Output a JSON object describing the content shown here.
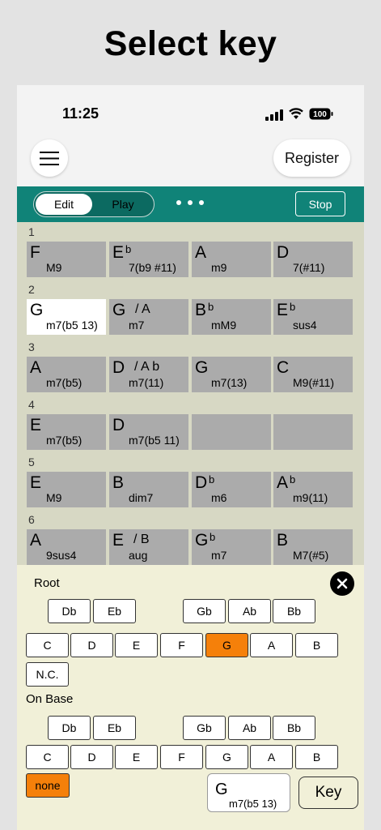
{
  "headline": "Select key",
  "status": {
    "time": "11:25",
    "battery": "100"
  },
  "header": {
    "register_label": "Register"
  },
  "toolbar": {
    "edit_label": "Edit",
    "play_label": "Play",
    "stop_label": "Stop"
  },
  "rows": [
    {
      "num": "1",
      "cells": [
        {
          "root": "F",
          "acc": "",
          "on": "",
          "qual": "M9"
        },
        {
          "root": "E",
          "acc": "b",
          "on": "",
          "qual": "7(b9 #11)"
        },
        {
          "root": "A",
          "acc": "",
          "on": "",
          "qual": "m9"
        },
        {
          "root": "D",
          "acc": "",
          "on": "",
          "qual": "7(#11)"
        }
      ]
    },
    {
      "num": "2",
      "cells": [
        {
          "root": "G",
          "acc": "",
          "on": "",
          "qual": "m7(b5 13)",
          "selected": true
        },
        {
          "root": "G",
          "acc": "",
          "on": "/ A",
          "qual": "m7"
        },
        {
          "root": "B",
          "acc": "b",
          "on": "",
          "qual": "mM9"
        },
        {
          "root": "E",
          "acc": "b",
          "on": "",
          "qual": "sus4"
        }
      ]
    },
    {
      "num": "3",
      "cells": [
        {
          "root": "A",
          "acc": "",
          "on": "",
          "qual": "m7(b5)"
        },
        {
          "root": "D",
          "acc": "",
          "on": "/ A b",
          "qual": "m7(11)"
        },
        {
          "root": "G",
          "acc": "",
          "on": "",
          "qual": "m7(13)"
        },
        {
          "root": "C",
          "acc": "",
          "on": "",
          "qual": "M9(#11)"
        }
      ]
    },
    {
      "num": "4",
      "cells": [
        {
          "root": "E",
          "acc": "",
          "on": "",
          "qual": "m7(b5)"
        },
        {
          "root": "D",
          "acc": "",
          "on": "",
          "qual": "m7(b5 11)"
        },
        {
          "root": "",
          "acc": "",
          "on": "",
          "qual": ""
        },
        {
          "root": "",
          "acc": "",
          "on": "",
          "qual": ""
        }
      ]
    },
    {
      "num": "5",
      "cells": [
        {
          "root": "E",
          "acc": "",
          "on": "",
          "qual": "M9"
        },
        {
          "root": "B",
          "acc": "",
          "on": "",
          "qual": "dim7"
        },
        {
          "root": "D",
          "acc": "b",
          "on": "",
          "qual": "m6"
        },
        {
          "root": "A",
          "acc": "b",
          "on": "",
          "qual": "m9(11)"
        }
      ]
    },
    {
      "num": "6",
      "cells": [
        {
          "root": "A",
          "acc": "",
          "on": "",
          "qual": "9sus4"
        },
        {
          "root": "E",
          "acc": "",
          "on": "/ B",
          "qual": "aug"
        },
        {
          "root": "G",
          "acc": "b",
          "on": "",
          "qual": "m7"
        },
        {
          "root": "B",
          "acc": "",
          "on": "",
          "qual": "M7(#5)"
        }
      ]
    }
  ],
  "panel": {
    "root_label": "Root",
    "onbase_label": "On Base",
    "sharps": [
      "Db",
      "Eb",
      "Gb",
      "Ab",
      "Bb"
    ],
    "naturals": [
      "C",
      "D",
      "E",
      "F",
      "G",
      "A",
      "B"
    ],
    "nc_label": "N.C.",
    "none_label": "none",
    "selected_root": "G",
    "selected_base": "none",
    "preview": {
      "root": "G",
      "quality": "m7(b5 13)"
    },
    "key_label": "Key",
    "accent": "#f5800a"
  }
}
